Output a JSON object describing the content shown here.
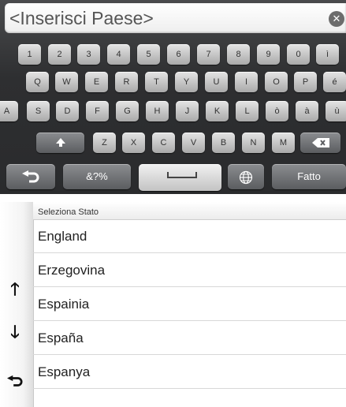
{
  "search": {
    "value": "<Inserisci Paese>"
  },
  "keyboard": {
    "row1": [
      "1",
      "2",
      "3",
      "4",
      "5",
      "6",
      "7",
      "8",
      "9",
      "0",
      "ì"
    ],
    "row2": [
      "Q",
      "W",
      "E",
      "R",
      "T",
      "Y",
      "U",
      "I",
      "O",
      "P",
      "é"
    ],
    "row3": [
      "A",
      "S",
      "D",
      "F",
      "G",
      "H",
      "J",
      "K",
      "L",
      "ò",
      "à",
      "ù"
    ],
    "row4": [
      "Z",
      "X",
      "C",
      "V",
      "B",
      "N",
      "M"
    ],
    "symbols_label": "&?%",
    "done_label": "Fatto"
  },
  "list": {
    "header": "Seleziona Stato",
    "items": [
      "England",
      "Erzegovina",
      "Espainia",
      "España",
      "Espanya"
    ]
  },
  "icons": {
    "clear": "clear-icon",
    "shift": "shift-icon",
    "backspace": "backspace-icon",
    "back": "back-arrow-icon",
    "globe": "globe-icon",
    "scroll_up": "arrow-up-icon",
    "scroll_down": "arrow-down-icon"
  }
}
